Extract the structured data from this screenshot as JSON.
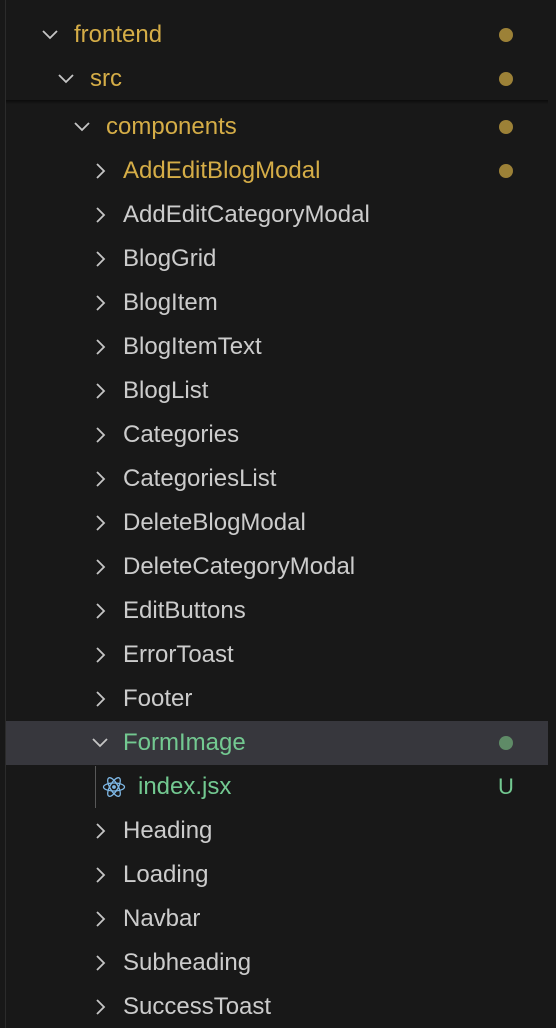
{
  "colors": {
    "modified": "#d5ad47",
    "modified_dot": "#9c8137",
    "untracked": "#73c991",
    "untracked_dot": "#5f8b67",
    "default_text": "#cccccc",
    "chevron": "#c5c5c5",
    "react_icon": "#7eb8e6",
    "selected_row": "#37373d"
  },
  "tree": {
    "frontend": {
      "label": "frontend",
      "chevron": "chevron-down-icon"
    },
    "src": {
      "label": "src",
      "chevron": "chevron-down-icon"
    },
    "components": {
      "label": "components",
      "chevron": "chevron-down-icon"
    },
    "folders": [
      {
        "label": "AddEditBlogModal",
        "status": "modified"
      },
      {
        "label": "AddEditCategoryModal"
      },
      {
        "label": "BlogGrid"
      },
      {
        "label": "BlogItem"
      },
      {
        "label": "BlogItemText"
      },
      {
        "label": "BlogList"
      },
      {
        "label": "Categories"
      },
      {
        "label": "CategoriesList"
      },
      {
        "label": "DeleteBlogModal"
      },
      {
        "label": "DeleteCategoryModal"
      },
      {
        "label": "EditButtons"
      },
      {
        "label": "ErrorToast"
      },
      {
        "label": "Footer"
      }
    ],
    "form_image": {
      "label": "FormImage",
      "status": "untracked"
    },
    "index_file": {
      "label": "index.jsx",
      "badge": "U",
      "icon": "react-icon"
    },
    "folders_after": [
      {
        "label": "Heading"
      },
      {
        "label": "Loading"
      },
      {
        "label": "Navbar"
      },
      {
        "label": "Subheading"
      },
      {
        "label": "SuccessToast"
      }
    ]
  }
}
